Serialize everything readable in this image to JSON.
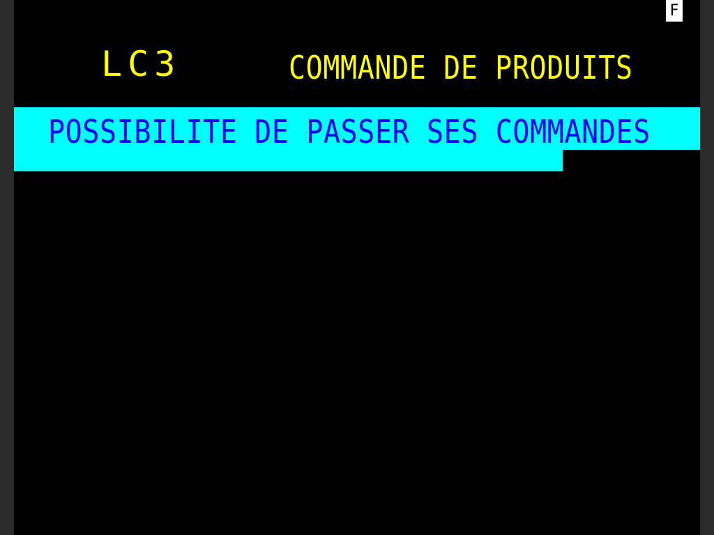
{
  "status_indicator": "F",
  "header": {
    "logo": "LC3",
    "title": "COMMANDE DE PRODUITS"
  },
  "banner": {
    "text": "POSSIBILITE DE PASSER SES COMMANDES"
  },
  "colors": {
    "background": "#000000",
    "title": "#ffff00",
    "banner_background": "#00ffff",
    "banner_text": "#0000ff",
    "indicator_background": "#ffffff"
  }
}
